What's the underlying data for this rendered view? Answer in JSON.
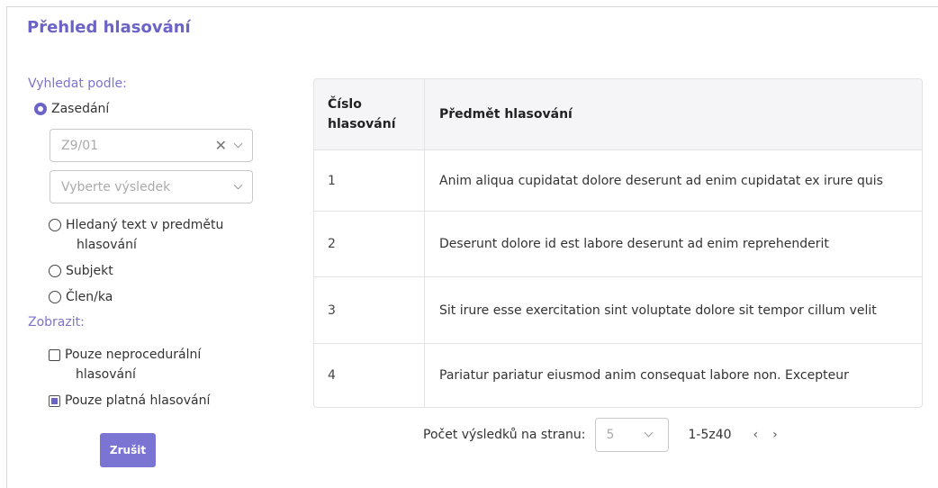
{
  "page": {
    "title": "Přehled hlasování"
  },
  "search": {
    "label": "Vyhledat podle:",
    "options": [
      {
        "label": "Zasedání",
        "selected": true
      },
      {
        "label": "Hledaný text v předmětu hlasování",
        "line1": "Hledaný text v predmětu",
        "line2": "hlasování",
        "selected": false
      },
      {
        "label": "Subjekt",
        "selected": false
      },
      {
        "label": "Člen/ka",
        "selected": false
      }
    ],
    "session_select": {
      "value": "Z9/01"
    },
    "result_select": {
      "placeholder": "Vyberte výsledek"
    }
  },
  "display": {
    "label": "Zobrazit:",
    "checkboxes": [
      {
        "line1": "Pouze neprocedurální",
        "line2": "hlasování",
        "checked": false
      },
      {
        "line1": "Pouze platná hlasování",
        "checked": true
      }
    ]
  },
  "cancel_button": {
    "label": "Zrušit"
  },
  "table": {
    "headers": {
      "number_line1": "Číslo",
      "number_line2": "hlasování",
      "subject": "Předmět hlasování"
    },
    "rows": [
      {
        "number": "1",
        "subject": "Anim aliqua cupidatat dolore deserunt ad enim cupidatat ex irure quis"
      },
      {
        "number": "2",
        "subject": "Deserunt dolore id est labore deserunt ad enim reprehenderit"
      },
      {
        "number": "3",
        "subject": "Sit irure esse exercitation sint voluptate dolore sit tempor cillum velit"
      },
      {
        "number": "4",
        "subject": "Pariatur pariatur eiusmod anim consequat labore non. Excepteur"
      }
    ]
  },
  "pagination": {
    "per_page_label": "Počet výsledků na stranu:",
    "per_page_value": "5",
    "range": "1-5z40",
    "prev": "‹",
    "next": "›"
  },
  "colors": {
    "accent": "#6b63c7",
    "button": "#7b74d3"
  }
}
